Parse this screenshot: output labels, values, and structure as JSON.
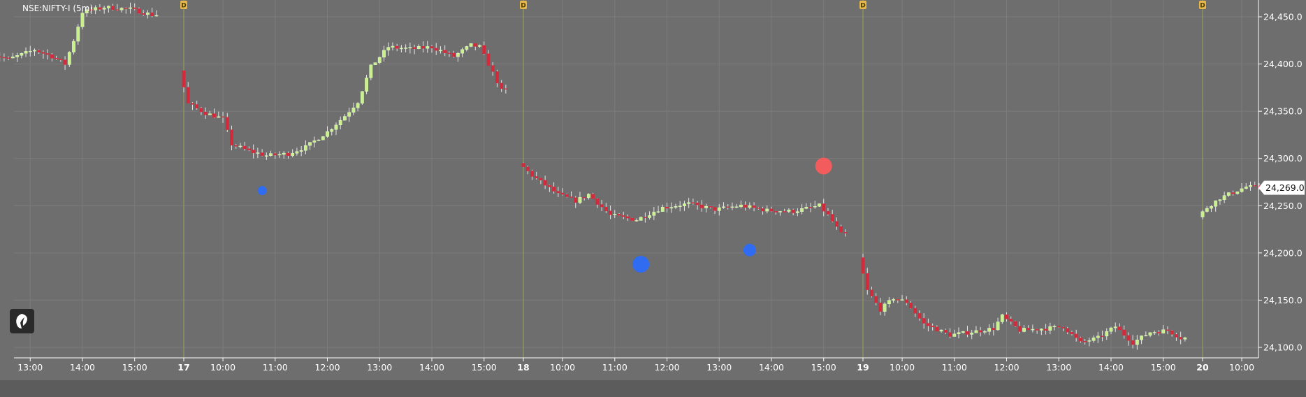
{
  "symbol_label": "NSE:NIFTY-I (5m)",
  "colors": {
    "background": "#6e6e6e",
    "grid": "#7c7c7c",
    "up_candle": "#c9f08a",
    "down_candle": "#d42a3c",
    "big_candle": "#1a1ab0",
    "day_separator": "#9ea25a",
    "day_marker": "#e8b84a",
    "marker_blue": "#2f6cf2",
    "marker_red": "#f25c5c",
    "price_tag_bg": "#ffffff",
    "bottom_bar": "#5c5c5c"
  },
  "icons": {
    "watermark": "fyers-logo-icon"
  },
  "day_marker_label": "D",
  "chart_data": {
    "type": "candlestick",
    "title": "NSE:NIFTY-I (5m)",
    "xlabel": "",
    "ylabel": "",
    "ylim": [
      24088,
      24475
    ],
    "y_ticks": [
      "24,100.0",
      "24,150.0",
      "24,200.0",
      "24,250.0",
      "24,300.0",
      "24,350.0",
      "24,400.0",
      "24,450.0"
    ],
    "y_tick_values": [
      24100,
      24150,
      24200,
      24250,
      24300,
      24350,
      24400,
      24450
    ],
    "x_ticks": [
      {
        "label": "13:00",
        "day": 0,
        "time": "13:00"
      },
      {
        "label": "14:00",
        "day": 0,
        "time": "14:00"
      },
      {
        "label": "15:00",
        "day": 0,
        "time": "15:00"
      },
      {
        "label": "17",
        "day": 1,
        "time": "09:15",
        "is_day": true
      },
      {
        "label": "10:00",
        "day": 1,
        "time": "10:00"
      },
      {
        "label": "11:00",
        "day": 1,
        "time": "11:00"
      },
      {
        "label": "12:00",
        "day": 1,
        "time": "12:00"
      },
      {
        "label": "13:00",
        "day": 1,
        "time": "13:00"
      },
      {
        "label": "14:00",
        "day": 1,
        "time": "14:00"
      },
      {
        "label": "15:00",
        "day": 1,
        "time": "15:00"
      },
      {
        "label": "18",
        "day": 2,
        "time": "09:15",
        "is_day": true
      },
      {
        "label": "10:00",
        "day": 2,
        "time": "10:00"
      },
      {
        "label": "11:00",
        "day": 2,
        "time": "11:00"
      },
      {
        "label": "12:00",
        "day": 2,
        "time": "12:00"
      },
      {
        "label": "13:00",
        "day": 2,
        "time": "13:00"
      },
      {
        "label": "14:00",
        "day": 2,
        "time": "14:00"
      },
      {
        "label": "15:00",
        "day": 2,
        "time": "15:00"
      },
      {
        "label": "19",
        "day": 3,
        "time": "09:15",
        "is_day": true
      },
      {
        "label": "10:00",
        "day": 3,
        "time": "10:00"
      },
      {
        "label": "11:00",
        "day": 3,
        "time": "11:00"
      },
      {
        "label": "12:00",
        "day": 3,
        "time": "12:00"
      },
      {
        "label": "13:00",
        "day": 3,
        "time": "13:00"
      },
      {
        "label": "14:00",
        "day": 3,
        "time": "14:00"
      },
      {
        "label": "15:00",
        "day": 3,
        "time": "15:00"
      },
      {
        "label": "20",
        "day": 4,
        "time": "09:15",
        "is_day": true
      },
      {
        "label": "10:00",
        "day": 4,
        "time": "10:00"
      }
    ],
    "sessions": [
      {
        "day": 0,
        "start": "12:15",
        "end": "15:25",
        "path": [
          [
            "12:15",
            24412
          ],
          [
            "12:40",
            24405
          ],
          [
            "13:10",
            24415
          ],
          [
            "13:30",
            24408
          ],
          [
            "13:45",
            24400
          ],
          [
            "13:55",
            24425
          ],
          [
            "14:05",
            24455
          ],
          [
            "14:30",
            24460
          ],
          [
            "15:00",
            24458
          ],
          [
            "15:25",
            24452
          ]
        ]
      },
      {
        "day": 1,
        "start": "09:15",
        "end": "15:25",
        "path": [
          [
            "09:15",
            24393
          ],
          [
            "09:25",
            24358
          ],
          [
            "09:45",
            24348
          ],
          [
            "10:05",
            24342
          ],
          [
            "10:15",
            24315
          ],
          [
            "10:35",
            24308
          ],
          [
            "10:55",
            24303
          ],
          [
            "11:20",
            24305
          ],
          [
            "11:40",
            24312
          ],
          [
            "12:05",
            24328
          ],
          [
            "12:25",
            24345
          ],
          [
            "12:40",
            24360
          ],
          [
            "12:55",
            24397
          ],
          [
            "13:15",
            24418
          ],
          [
            "13:40",
            24416
          ],
          [
            "14:05",
            24418
          ],
          [
            "14:30",
            24408
          ],
          [
            "14:50",
            24420
          ],
          [
            "15:00",
            24418
          ],
          [
            "15:10",
            24400
          ],
          [
            "15:25",
            24372
          ]
        ]
      },
      {
        "day": 2,
        "start": "09:15",
        "end": "15:25",
        "path": [
          [
            "09:15",
            24295
          ],
          [
            "09:30",
            24282
          ],
          [
            "10:00",
            24262
          ],
          [
            "10:20",
            24255
          ],
          [
            "10:35",
            24262
          ],
          [
            "11:00",
            24240
          ],
          [
            "11:30",
            24235
          ],
          [
            "12:00",
            24248
          ],
          [
            "12:30",
            24252
          ],
          [
            "13:00",
            24246
          ],
          [
            "13:30",
            24250
          ],
          [
            "14:00",
            24245
          ],
          [
            "14:30",
            24244
          ],
          [
            "15:00",
            24250
          ],
          [
            "15:10",
            24240
          ],
          [
            "15:25",
            24220
          ]
        ]
      },
      {
        "day": 3,
        "start": "09:15",
        "end": "15:25",
        "path": [
          [
            "09:15",
            24195
          ],
          [
            "09:25",
            24160
          ],
          [
            "09:40",
            24140
          ],
          [
            "09:55",
            24152
          ],
          [
            "10:10",
            24148
          ],
          [
            "10:30",
            24125
          ],
          [
            "11:00",
            24113
          ],
          [
            "11:30",
            24117
          ],
          [
            "11:50",
            24120
          ],
          [
            "12:00",
            24133
          ],
          [
            "12:20",
            24118
          ],
          [
            "12:50",
            24120
          ],
          [
            "13:10",
            24122
          ],
          [
            "13:30",
            24105
          ],
          [
            "13:50",
            24110
          ],
          [
            "14:10",
            24122
          ],
          [
            "14:30",
            24105
          ],
          [
            "14:50",
            24116
          ],
          [
            "15:10",
            24118
          ],
          [
            "15:25",
            24110
          ]
        ]
      },
      {
        "day": 4,
        "start": "09:15",
        "end": "10:25",
        "path": [
          [
            "09:15",
            24238
          ],
          [
            "09:25",
            24248
          ],
          [
            "09:40",
            24258
          ],
          [
            "09:55",
            24264
          ],
          [
            "10:10",
            24270
          ],
          [
            "10:25",
            24269
          ]
        ]
      }
    ],
    "markers": [
      {
        "day": 1,
        "time": "10:45",
        "price": 24266,
        "color": "blue",
        "size": "small"
      },
      {
        "day": 2,
        "time": "11:30",
        "price": 24188,
        "color": "blue",
        "size": "large"
      },
      {
        "day": 2,
        "time": "13:35",
        "price": 24203,
        "color": "blue",
        "size": "medium"
      },
      {
        "day": 2,
        "time": "15:00",
        "price": 24292,
        "color": "red",
        "size": "large"
      }
    ],
    "last_price": 24269.0,
    "last_price_label": "24,269.0",
    "grid": true
  }
}
